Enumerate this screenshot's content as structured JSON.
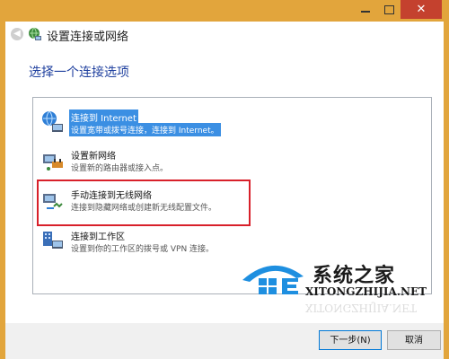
{
  "window": {
    "close_glyph": "✕",
    "accent": "#e2a53c",
    "close_color": "#c4412e"
  },
  "nav": {
    "back_glyph": "◀",
    "title": "设置连接或网络"
  },
  "main": {
    "heading": "选择一个连接选项",
    "options": [
      {
        "icon": "internet-connection-icon",
        "title": "连接到 Internet",
        "desc": "设置宽带或拨号连接，连接到 Internet。",
        "selected": true
      },
      {
        "icon": "router-icon",
        "title": "设置新网络",
        "desc": "设置新的路由器或接入点。",
        "selected": false
      },
      {
        "icon": "wireless-network-icon",
        "title": "手动连接到无线网络",
        "desc": "连接到隐藏网络或创建新无线配置文件。",
        "selected": false,
        "highlighted": true
      },
      {
        "icon": "workplace-network-icon",
        "title": "连接到工作区",
        "desc": "设置到你的工作区的拨号或 VPN 连接。",
        "selected": false
      }
    ]
  },
  "watermark": {
    "brand": "系统之家",
    "url": "XITONGZHIJIA.NET",
    "logo_icon": "system-home-logo-icon"
  },
  "footer": {
    "next_label": "下一步(N)",
    "cancel_label": "取消"
  }
}
